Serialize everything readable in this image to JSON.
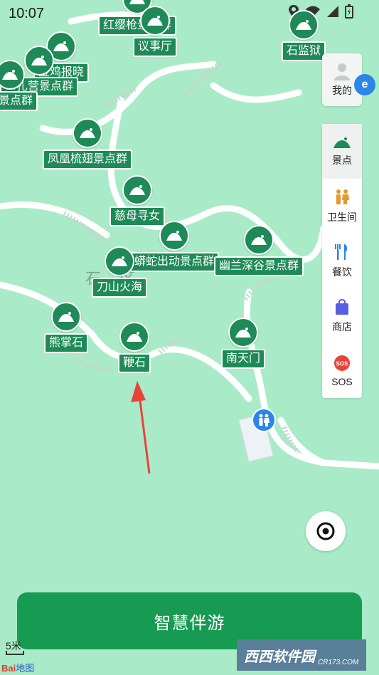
{
  "status_bar": {
    "time": "10:07"
  },
  "map": {
    "area_label": "石…区",
    "pois": [
      {
        "id": "hongyingqiang",
        "label": "红缨枪景点群"
      },
      {
        "id": "yishiting",
        "label": "议事厅"
      },
      {
        "id": "shijianyu",
        "label": "石监狱"
      },
      {
        "id": "jinjibaoxiao",
        "label": "金鸡报晓"
      },
      {
        "id": "zhazhai",
        "label": "…扎营景点群"
      },
      {
        "id": "ting",
        "label": "厅景点群"
      },
      {
        "id": "fenghuang",
        "label": "凤凰梳翅景点群"
      },
      {
        "id": "cimuxunnv",
        "label": "慈母寻女"
      },
      {
        "id": "mangshe",
        "label": "蟒蛇出动景点群"
      },
      {
        "id": "youlan",
        "label": "幽兰深谷景点群"
      },
      {
        "id": "daoshan",
        "label": "刀山火海"
      },
      {
        "id": "xiongzhang",
        "label": "熊掌石"
      },
      {
        "id": "bianshi",
        "label": "鞭石"
      },
      {
        "id": "nantianmen",
        "label": "南天门"
      }
    ]
  },
  "side_panel": {
    "profile_label": "我的",
    "menu": [
      {
        "id": "scenic",
        "label": "景点",
        "active": true,
        "icon": "scenic-spot-icon"
      },
      {
        "id": "toilet",
        "label": "卫生间",
        "active": false,
        "icon": "toilet-icon"
      },
      {
        "id": "dining",
        "label": "餐饮",
        "active": false,
        "icon": "dining-icon"
      },
      {
        "id": "shop",
        "label": "商店",
        "active": false,
        "icon": "shop-icon"
      },
      {
        "id": "sos",
        "label": "SOS",
        "active": false,
        "icon": "sos-icon"
      }
    ]
  },
  "guide_button": {
    "label": "智慧伴游"
  },
  "scale": {
    "label": "5米"
  },
  "logos": {
    "baidu": "Bai",
    "baidu_suffix": "地图",
    "watermark": "西西软件园",
    "watermark_site": "CR173.COM"
  },
  "colors": {
    "map_bg": "#a9ebc8",
    "poi_green": "#1e8a57",
    "button_green": "#179a52",
    "accent_blue": "#2b86e8",
    "arrow_red": "#e8433b"
  }
}
